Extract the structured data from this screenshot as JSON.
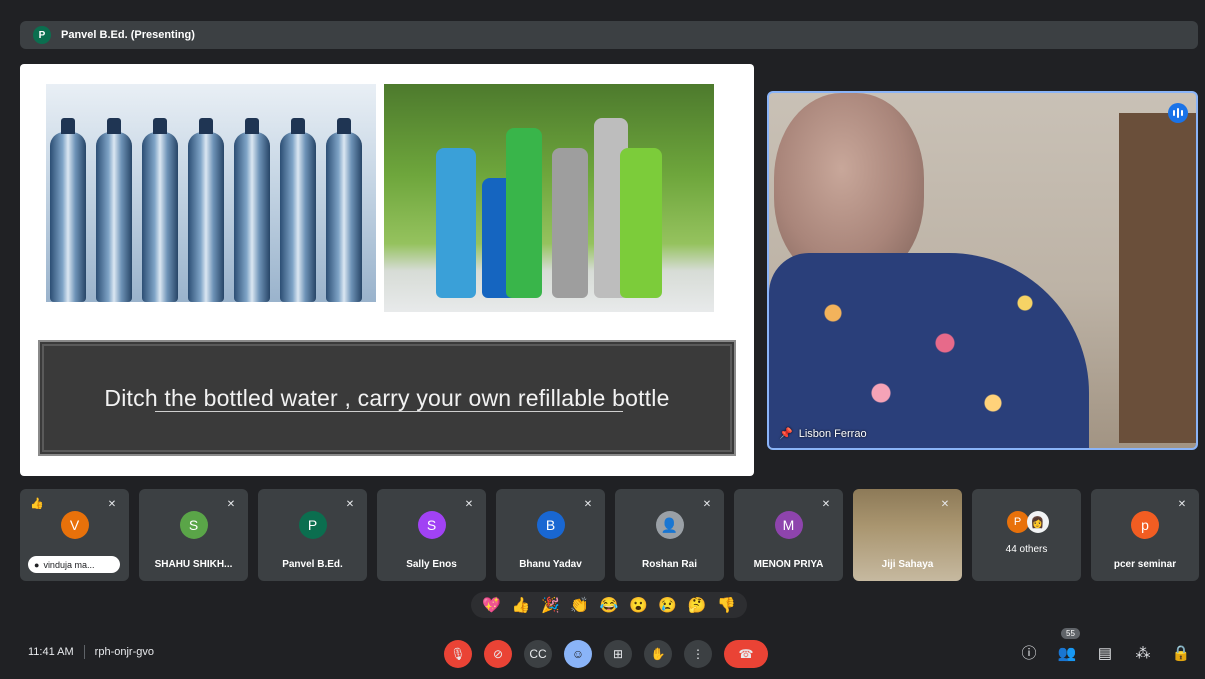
{
  "presenter_bar": {
    "avatar_letter": "P",
    "title": "Panvel B.Ed. (Presenting)"
  },
  "slide": {
    "caption": "Ditch the bottled water , carry your own refillable bottle"
  },
  "speaker": {
    "name": "Lisbon Ferrao"
  },
  "tiles": [
    {
      "name": "vinduja ma...",
      "letter": "V",
      "color": "#e8710a",
      "reaction": "👍"
    },
    {
      "name": "SHAHU SHIKH...",
      "letter": "S",
      "color": "#5aa548"
    },
    {
      "name": "Panvel B.Ed.",
      "letter": "P",
      "color": "#0b6e4f"
    },
    {
      "name": "Sally Enos",
      "letter": "S",
      "color": "#a142f4"
    },
    {
      "name": "Bhanu Yadav",
      "letter": "B",
      "color": "#1967d2"
    },
    {
      "name": "Roshan Rai",
      "letter": "",
      "color": "#9aa0a6"
    },
    {
      "name": "MENON PRIYA",
      "letter": "M",
      "color": "#8e44ad"
    },
    {
      "name": "Jiji Sahaya",
      "letter": "",
      "color": "#8d7a58"
    },
    {
      "name": "44 others",
      "letter": "P",
      "color": "#e8710a"
    },
    {
      "name": "pcer seminar",
      "letter": "p",
      "color": "#f25d22"
    }
  ],
  "reactions": [
    "💖",
    "👍",
    "🎉",
    "👏",
    "😂",
    "😮",
    "😢",
    "🤔",
    "👎"
  ],
  "meeting": {
    "time": "11:41 AM",
    "code": "rph-onjr-gvo"
  },
  "people_count": "55",
  "icons": {
    "mic_off": "mic-off-icon",
    "cam_off": "camera-off-icon",
    "captions": "captions-icon",
    "emoji": "emoji-icon",
    "present": "present-icon",
    "hand": "raise-hand-icon",
    "more": "more-icon",
    "end": "end-call-icon"
  }
}
